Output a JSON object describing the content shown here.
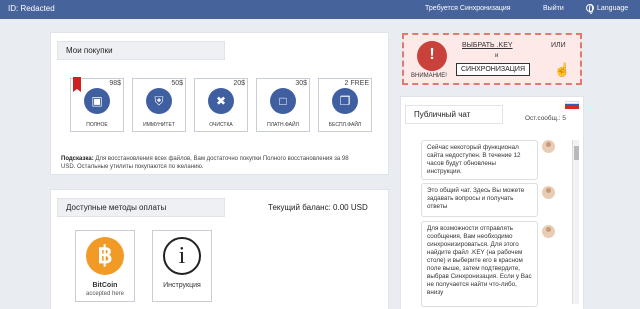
{
  "topbar": {
    "id_label": "ID: Redacted",
    "sync_label": "Требуется Синхронизация",
    "exit_label": "Выйти",
    "language_label": "Language"
  },
  "purchases": {
    "title": "Мои покупки",
    "products": [
      {
        "price": "98$",
        "name": "ПОЛНОЕ",
        "icon": "laptop-icon"
      },
      {
        "price": "50$",
        "name": "ИММУНИТЕТ",
        "icon": "shield-icon"
      },
      {
        "price": "20$",
        "name": "ОЧИСТКА",
        "icon": "tools-icon"
      },
      {
        "price": "30$",
        "name": "ПЛАТН.ФАЙЛ",
        "icon": "file-icon"
      },
      {
        "price": "2 FREE",
        "name": "БЕСПЛ.ФАЙЛ",
        "icon": "files-icon"
      }
    ],
    "hint_bold": "Подсказка:",
    "hint_text": "Для восстановления всех файлов, Вам достаточно покупки Полного восстановления за 98 USD. Остальные утилиты покупаются по желанию."
  },
  "payments": {
    "title": "Доступные методы оплаты",
    "balance": "Текущий баланс: 0.00 USD",
    "methods": [
      {
        "label": "BitCoin",
        "sub": "accepted here"
      },
      {
        "label": "Инструкция"
      }
    ]
  },
  "keybox": {
    "select_key": "ВЫБРАТЬ .KEY",
    "or": "ИЛИ",
    "and": "и",
    "sync_button": "СИНХРОНИЗАЦИЯ",
    "warning": "ВНИМАНИЕ!"
  },
  "chat": {
    "title": "Публичный чат",
    "remaining": "Ост.сообщ.: 5",
    "messages": [
      "Сейчас некоторый функционал сайта недоступен. В течение 12 часов будут обновлены инструкции.",
      "Это общий чат. Здесь Вы можете задавать вопросы и получать ответы",
      "Для возможности отправлять сообщения, Вам необходимо синхронизироваться. Для этого найдите файл .KEY (на рабочем столе) и выберите его в красном поле выше, затем подтвердите, выбрав Синхронизация. Если у Вас не получается найти что-либо, внизу"
    ]
  },
  "colors": {
    "topbar": "#46639b",
    "accent": "#3f5fa0",
    "warning": "#c8413a",
    "bitcoin": "#f29a26"
  }
}
